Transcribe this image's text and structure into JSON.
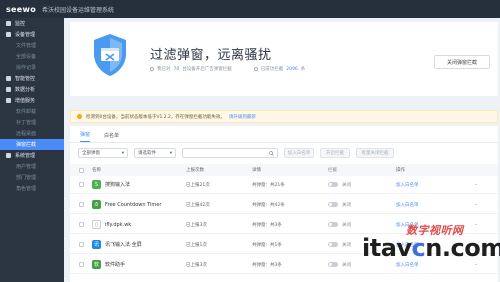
{
  "topbar": {
    "logo": "seewo",
    "title": "希沃校园设备运维管理系统"
  },
  "sidebar": {
    "items": [
      {
        "label": "监控",
        "kind": "head"
      },
      {
        "label": "设备管理",
        "kind": "head"
      },
      {
        "label": "文件管理",
        "kind": "sub"
      },
      {
        "label": "全部设备",
        "kind": "sub"
      },
      {
        "label": "操作记录",
        "kind": "sub"
      },
      {
        "label": "智能管控",
        "kind": "head"
      },
      {
        "label": "数据分析",
        "kind": "head"
      },
      {
        "label": "增值服务",
        "kind": "head"
      },
      {
        "label": "软件卸载",
        "kind": "sub"
      },
      {
        "label": "补丁管理",
        "kind": "sub"
      },
      {
        "label": "远程桌面",
        "kind": "sub"
      },
      {
        "label": "弹窗拦截",
        "kind": "active"
      },
      {
        "label": "系统管理",
        "kind": "head"
      },
      {
        "label": "用户管理",
        "kind": "sub"
      },
      {
        "label": "部门管理",
        "kind": "sub"
      },
      {
        "label": "角色管理",
        "kind": "sub"
      }
    ]
  },
  "hero": {
    "title": "过滤弹窗，远离骚扰",
    "stats": [
      {
        "prefix": "我已对",
        "value": "70",
        "suffix": "台设备开启广告弹窗拦截"
      },
      {
        "prefix": "已成功拦截",
        "value": "2096",
        "suffix": "条"
      }
    ],
    "close_button": "关闭弹窗拦截"
  },
  "notice": {
    "text": "检测到0台设备，当前状态版本低于V1.2.2，存在弹窗拦截功能失效。",
    "link": "请升级到最新"
  },
  "tabs": [
    {
      "label": "弹窗",
      "active": true
    },
    {
      "label": "白名单",
      "active": false
    }
  ],
  "filters": {
    "select1": "全部弹窗",
    "select2": "请选软件",
    "buttons": [
      "加入白名单",
      "开启拦截",
      "批量关闭拦截"
    ]
  },
  "table": {
    "headers": [
      "名称",
      "上报次数",
      "详情",
      "拦截",
      "操作"
    ],
    "rows": [
      {
        "name": "搜狗输入法",
        "reports": "已上报21次",
        "detail": "共弹窗：共21条",
        "block": "关闭",
        "op": "加入白名单",
        "icon_color": "#4caf50",
        "icon_glyph": "S"
      },
      {
        "name": "Free Countdown Timer",
        "reports": "已上报42次",
        "detail": "共弹窗：共42条",
        "block": "关闭",
        "op": "加入白名单",
        "icon_color": "#43a047",
        "icon_glyph": "⏱"
      },
      {
        "name": "ifly.dpk.wk",
        "reports": "已上报3次",
        "detail": "共弹窗：共3条",
        "block": "关闭",
        "op": "加入白名单",
        "icon_color": "#ffffff",
        "icon_glyph": "▯"
      },
      {
        "name": "讯飞输入法·全屏",
        "reports": "已上报1次",
        "detail": "共弹窗：共1条",
        "block": "关闭",
        "op": "加入白名单",
        "icon_color": "#1e88e5",
        "icon_glyph": "讯"
      },
      {
        "name": "软件助手",
        "reports": "已上报3次",
        "detail": "共弹窗：共3条",
        "block": "关闭",
        "op": "加入白名单",
        "icon_color": "#43a047",
        "icon_glyph": "软"
      }
    ]
  },
  "watermark": {
    "cn": "数字视听网",
    "en_prefix": "itav",
    "en_accent": "c",
    "en_suffix": "n.com"
  }
}
